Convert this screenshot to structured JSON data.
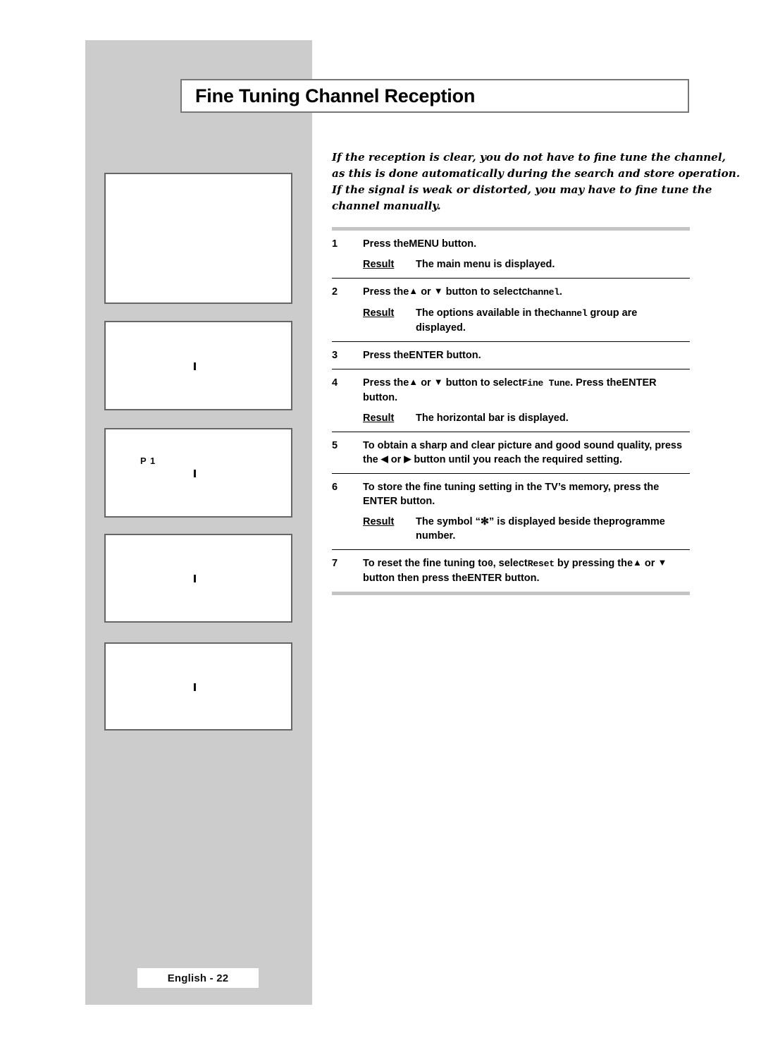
{
  "page": {
    "title": "Fine Tuning Channel Reception",
    "footer_label": "English - 22"
  },
  "intro": {
    "lines": [
      "If the reception is clear, you do not have to fine tune the channel,",
      "as this is done automatically during the search and store operation.",
      "If the signal is weak or distorted, you may have to fine tune the",
      "channel manually."
    ]
  },
  "illustrations": [
    {
      "name": "main-menu-screen",
      "label": ""
    },
    {
      "name": "channel-menu-screen",
      "label": ""
    },
    {
      "name": "fine-tune-bar-screen",
      "label": "P 1"
    },
    {
      "name": "fine-tune-stored-screen",
      "label": ""
    },
    {
      "name": "reset-screen",
      "label": ""
    }
  ],
  "steps": [
    {
      "num": "1",
      "text_parts": [
        {
          "t": "Press the ",
          "style": "normal"
        },
        {
          "t": "MENU",
          "style": "normal"
        },
        {
          "t": " button.",
          "style": "normal"
        }
      ],
      "plain": "Press the MENU button.",
      "result_label": "Result",
      "result_text": "The main menu is displayed."
    },
    {
      "num": "2",
      "plain": "Press the ▲ or ▼ button to select Channel.",
      "result_label": "Result",
      "result_text": "The options available in the Channel group are displayed."
    },
    {
      "num": "3",
      "plain": "Press the ENTER button.",
      "result_label": "",
      "result_text": ""
    },
    {
      "num": "4",
      "plain": "Press the ▲ or ▼ button to select Fine Tune. Press the ENTER button.",
      "result_label": "Result",
      "result_text": "The horizontal bar is displayed."
    },
    {
      "num": "5",
      "plain": "To obtain a sharp and clear picture and good sound quality, press the ◀ or ▶ button until you reach the required setting.",
      "result_label": "",
      "result_text": ""
    },
    {
      "num": "6",
      "plain": "To store the fine tuning setting in the TV’s memory, press the ENTER button.",
      "result_label": "Result",
      "result_text": "The symbol “✻” is displayed beside the programme number."
    },
    {
      "num": "7",
      "plain": "To reset the fine tuning to 0, select Reset by pressing the ▲ or ▼ button then press the ENTER button.",
      "result_label": "",
      "result_text": ""
    }
  ],
  "step_text": {
    "s1_a": "Press the",
    "s1_b": "MENU",
    "s1_c": " button.",
    "s1_result_label": "Result",
    "s1_result": "The main menu is displayed.",
    "s2_a": "Press the",
    "s2_up": "▲",
    "s2_or": " or ",
    "s2_down": "▼",
    "s2_b": " button to select",
    "s2_mono": "Channel",
    "s2_c": ".",
    "s2_result_label": "Result",
    "s2_result_a": "The options available in the",
    "s2_result_mono": "Channel",
    "s2_result_b": " group are",
    "s2_result_c": "displayed.",
    "s3_a": "Press the",
    "s3_b": "ENTER",
    "s3_c": " button.",
    "s4_a": "Press the",
    "s4_up": "▲",
    "s4_or": " or ",
    "s4_down": "▼",
    "s4_b": " button to select",
    "s4_mono": "Fine Tune",
    "s4_c": ". Press the",
    "s4_d": "ENTER",
    "s4_e": "button.",
    "s4_result_label": "Result",
    "s4_result": "The horizontal bar is displayed.",
    "s5_a": "To obtain a sharp and clear picture and good sound quality, press",
    "s5_b": "the ",
    "s5_left": "◀",
    "s5_or": " or ",
    "s5_right": "▶",
    "s5_c": " button until you reach the required setting.",
    "s6_a": "To store the fine tuning setting in the TV’s memory, press the",
    "s6_b": "ENTER button.",
    "s6_result_label": "Result",
    "s6_result_a": "The symbol “",
    "s6_symbol": "✻",
    "s6_result_b": "” is displayed beside the",
    "s6_result_mono": "programme",
    "s6_result_c": "number.",
    "s7_a": "To reset the fine tuning to",
    "s7_zero": "0",
    "s7_b": ", select",
    "s7_mono": "Reset",
    "s7_c": " by pressing the",
    "s7_up": "▲",
    "s7_or": " or ",
    "s7_down": "▼",
    "s7_d": "button then press the",
    "s7_e": "ENTER",
    "s7_f": " button."
  },
  "colors": {
    "panel_gray": "#cccccc",
    "rule_black": "#000000",
    "rule_gray": "#c4c4c4",
    "box_border": "#666666"
  }
}
